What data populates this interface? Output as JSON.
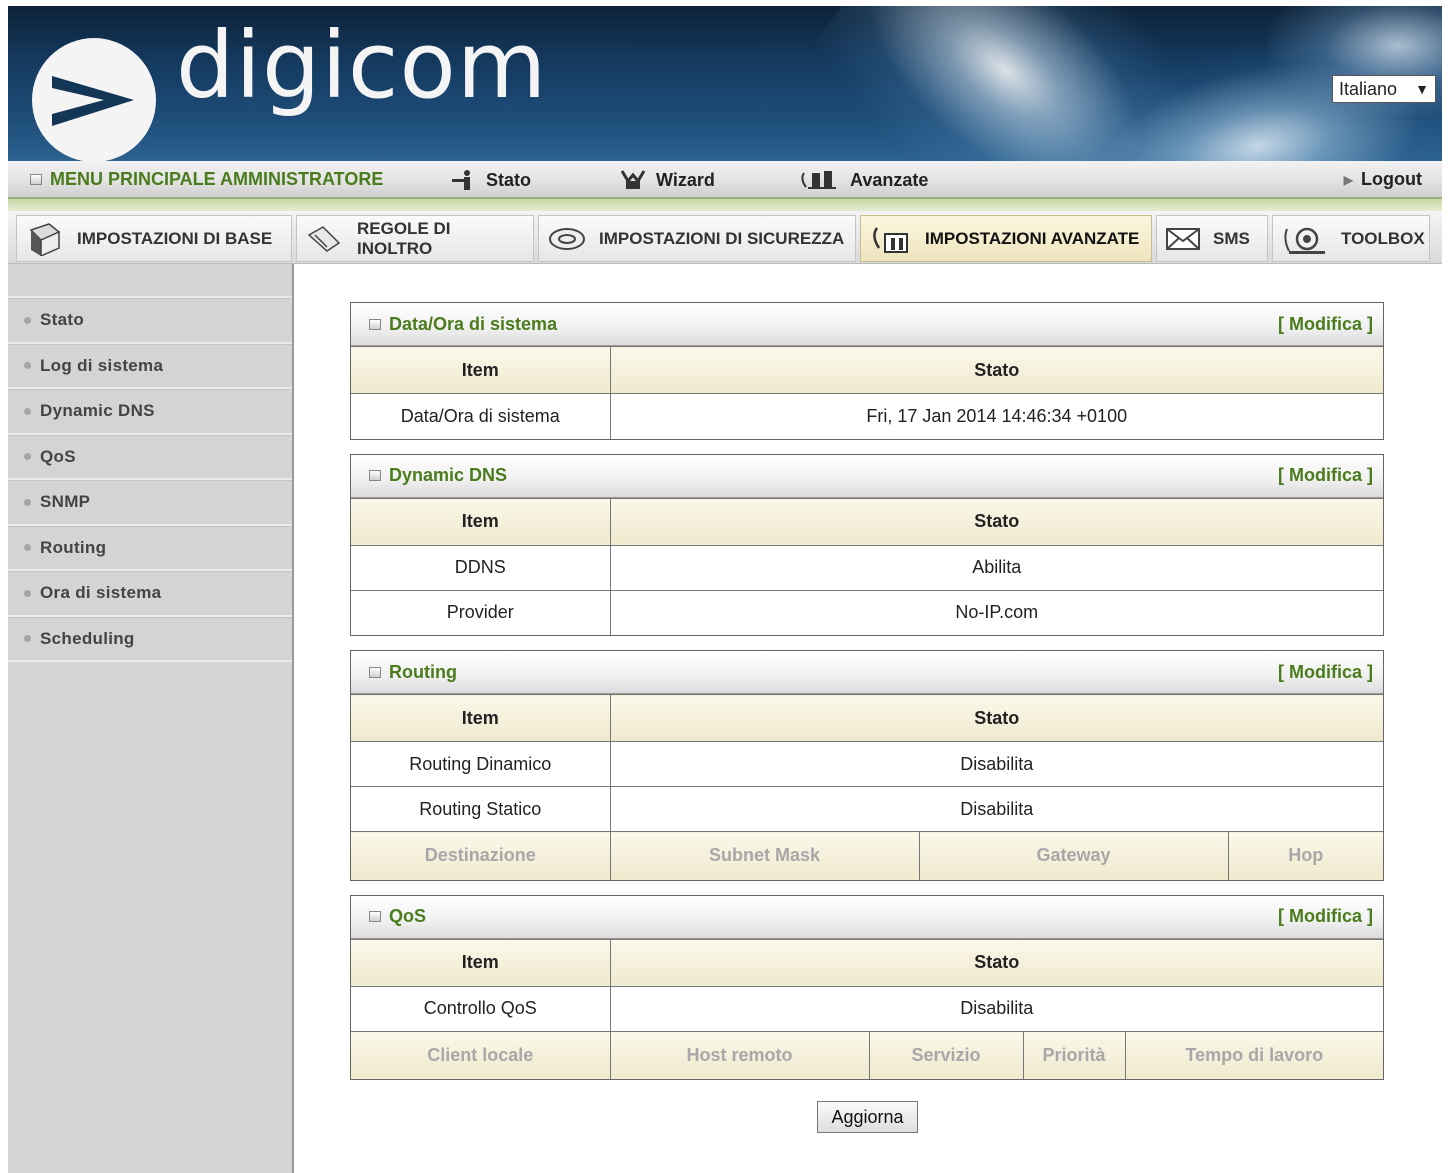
{
  "brand": {
    "logo_text": "digicom"
  },
  "language": {
    "selected": "Italiano"
  },
  "main_menu": {
    "admin": "MENU PRINCIPALE AMMINISTRATORE",
    "stato": "Stato",
    "wizard": "Wizard",
    "avanzate": "Avanzate",
    "logout": "Logout"
  },
  "tabs": [
    {
      "label": "IMPOSTAZIONI DI BASE",
      "icon": "notebook-icon"
    },
    {
      "label": "REGOLE DI INOLTRO",
      "icon": "forward-rules-icon"
    },
    {
      "label": "IMPOSTAZIONI DI SICUREZZA",
      "icon": "security-icon"
    },
    {
      "label": "IMPOSTAZIONI AVANZATE",
      "icon": "advanced-icon",
      "active": true
    },
    {
      "label": "SMS",
      "icon": "envelope-icon"
    },
    {
      "label": "TOOLBOX",
      "icon": "toolbox-icon"
    }
  ],
  "sidebar": {
    "items": [
      {
        "label": "Stato"
      },
      {
        "label": "Log di sistema"
      },
      {
        "label": "Dynamic DNS"
      },
      {
        "label": "QoS"
      },
      {
        "label": "SNMP"
      },
      {
        "label": "Routing"
      },
      {
        "label": "Ora di sistema"
      },
      {
        "label": "Scheduling"
      }
    ]
  },
  "panels": {
    "modify_label": "[ Modifica ]",
    "col_item": "Item",
    "col_stato": "Stato",
    "datetime": {
      "title": "Data/Ora di sistema",
      "rows": [
        {
          "item": "Data/Ora di sistema",
          "value": "Fri, 17 Jan 2014 14:46:34 +0100"
        }
      ]
    },
    "ddns": {
      "title": "Dynamic DNS",
      "rows": [
        {
          "item": "DDNS",
          "value": "Abilita"
        },
        {
          "item": "Provider",
          "value": "No-IP.com"
        }
      ]
    },
    "routing": {
      "title": "Routing",
      "rows": [
        {
          "item": "Routing Dinamico",
          "value": "Disabilita"
        },
        {
          "item": "Routing Statico",
          "value": "Disabilita"
        }
      ],
      "sub_headers": [
        "Destinazione",
        "Subnet Mask",
        "Gateway",
        "Hop"
      ]
    },
    "qos": {
      "title": "QoS",
      "rows": [
        {
          "item": "Controllo QoS",
          "value": "Disabilita"
        }
      ],
      "sub_headers": [
        "Client locale",
        "Host remoto",
        "Servizio",
        "Priorità",
        "Tempo di lavoro"
      ]
    }
  },
  "refresh_button": "Aggiorna",
  "colors": {
    "accent_green": "#4a7c1e",
    "header_beige": "#efe9cd",
    "sidebar_gray": "#d4d4d4"
  }
}
